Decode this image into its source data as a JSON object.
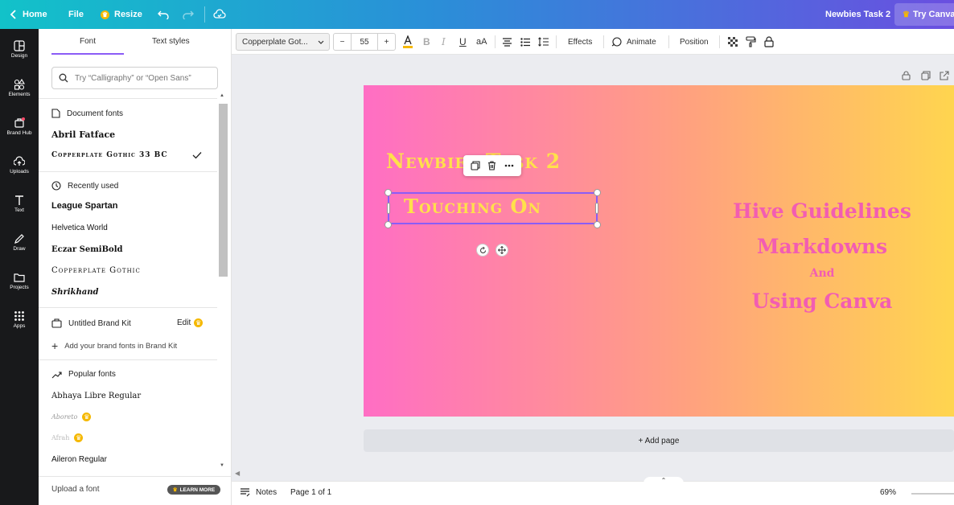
{
  "topbar": {
    "home_label": "Home",
    "file_label": "File",
    "resize_label": "Resize",
    "doc_title": "Newbies Task 2",
    "try_label": "Try Canva P"
  },
  "leftnav": {
    "items": [
      {
        "label": "Design"
      },
      {
        "label": "Elements"
      },
      {
        "label": "Brand Hub"
      },
      {
        "label": "Uploads"
      },
      {
        "label": "Text"
      },
      {
        "label": "Draw"
      },
      {
        "label": "Projects"
      },
      {
        "label": "Apps"
      }
    ]
  },
  "panel": {
    "tabs": [
      "Font",
      "Text styles"
    ],
    "search_placeholder": "Try “Calligraphy” or “Open Sans”",
    "document_fonts_title": "Document fonts",
    "document_fonts": [
      "Abril Fatface",
      "Copperplate Gothic 33 BC"
    ],
    "recently_used_title": "Recently used",
    "recently_used": [
      "League Spartan",
      "Helvetica World",
      "Eczar SemiBold",
      "Copperplate Gothic",
      "Shrikhand"
    ],
    "brand_kit_title": "Untitled Brand Kit",
    "brand_kit_edit": "Edit",
    "brand_kit_add": "Add your brand fonts in Brand Kit",
    "popular_title": "Popular fonts",
    "popular_fonts": [
      "Abhaya Libre Regular",
      "Aboreto",
      "Afrah",
      "Aileron Regular"
    ],
    "upload_label": "Upload a font",
    "learn_more": "LEARN MORE"
  },
  "toolbar": {
    "font_name": "Copperplate Got...",
    "font_size": "55",
    "minus": "−",
    "plus": "+",
    "case_label": "aA",
    "effects_label": "Effects",
    "animate_label": "Animate",
    "position_label": "Position"
  },
  "slide": {
    "title": "Newbies Task 2",
    "subtitle": "Touching On",
    "line1": "Hive Guidelines",
    "line2": "Markdowns",
    "line3": "And",
    "line4": "Using Canva",
    "add_page": "+ Add page"
  },
  "bottombar": {
    "notes_label": "Notes",
    "page_label": "Page 1 of 1",
    "zoom": "69%"
  },
  "colors": {
    "accent": "#8b5cf6",
    "gradient_start": "#ff6ec4",
    "gradient_end": "#ffd54f",
    "title_yellow": "#ffe14a",
    "pink_text": "#f25db2"
  }
}
